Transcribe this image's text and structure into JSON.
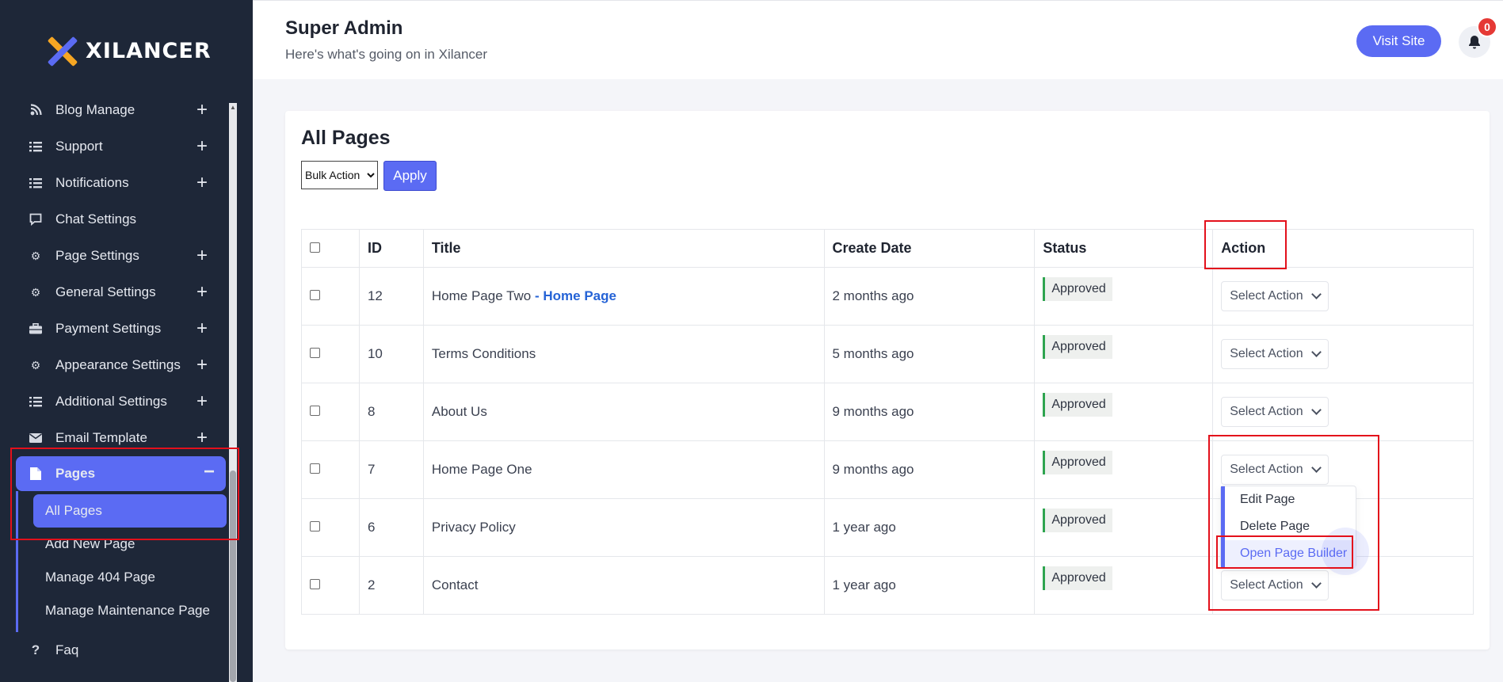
{
  "brand": {
    "name": "XILANCER"
  },
  "sidebar": {
    "items": [
      {
        "label": "Blog Manage",
        "icon": "blog-icon",
        "expandable": true
      },
      {
        "label": "Support",
        "icon": "list-icon",
        "expandable": true
      },
      {
        "label": "Notifications",
        "icon": "list-icon",
        "expandable": true
      },
      {
        "label": "Chat Settings",
        "icon": "chat-icon",
        "expandable": false
      },
      {
        "label": "Page Settings",
        "icon": "gear-icon",
        "expandable": true
      },
      {
        "label": "General Settings",
        "icon": "gear-icon",
        "expandable": true
      },
      {
        "label": "Payment Settings",
        "icon": "briefcase-icon",
        "expandable": true
      },
      {
        "label": "Appearance Settings",
        "icon": "gear-icon",
        "expandable": true
      },
      {
        "label": "Additional Settings",
        "icon": "list-icon",
        "expandable": true
      },
      {
        "label": "Email Template",
        "icon": "mail-icon",
        "expandable": true
      }
    ],
    "pages": {
      "label": "Pages",
      "toggle": "−",
      "sub": [
        "All Pages",
        "Add New Page",
        "Manage 404 Page",
        "Manage Maintenance Page"
      ]
    },
    "faq": {
      "label": "Faq",
      "icon": "?"
    }
  },
  "header": {
    "title": "Super Admin",
    "subtitle": "Here's what's going on in Xilancer",
    "visit_label": "Visit Site",
    "notif_count": "0"
  },
  "main": {
    "title": "All Pages",
    "bulk_option": "Bulk Action",
    "apply_label": "Apply",
    "columns": [
      "ID",
      "Title",
      "Create Date",
      "Status",
      "Action"
    ],
    "rows": [
      {
        "id": "12",
        "title": "Home Page Two",
        "suffix": "- Home Page",
        "date": "2 months ago",
        "status": "Approved",
        "action": "Select Action"
      },
      {
        "id": "10",
        "title": "Terms Conditions",
        "suffix": "",
        "date": "5 months ago",
        "status": "Approved",
        "action": "Select Action"
      },
      {
        "id": "8",
        "title": "About Us",
        "suffix": "",
        "date": "9 months ago",
        "status": "Approved",
        "action": "Select Action"
      },
      {
        "id": "7",
        "title": "Home Page One",
        "suffix": "",
        "date": "9 months ago",
        "status": "Approved",
        "action": "Select Action"
      },
      {
        "id": "6",
        "title": "Privacy Policy",
        "suffix": "",
        "date": "1 year ago",
        "status": "Approved",
        "action": "Select Action"
      },
      {
        "id": "2",
        "title": "Contact",
        "suffix": "",
        "date": "1 year ago",
        "status": "Approved",
        "action": "Select Action"
      }
    ],
    "dropdown": [
      "Edit Page",
      "Delete Page",
      "Open Page Builder"
    ]
  },
  "colors": {
    "accent": "#5b6bf3",
    "sidebar": "#1e2738",
    "annotation": "#e3101b",
    "approved": "#2ea44f"
  }
}
